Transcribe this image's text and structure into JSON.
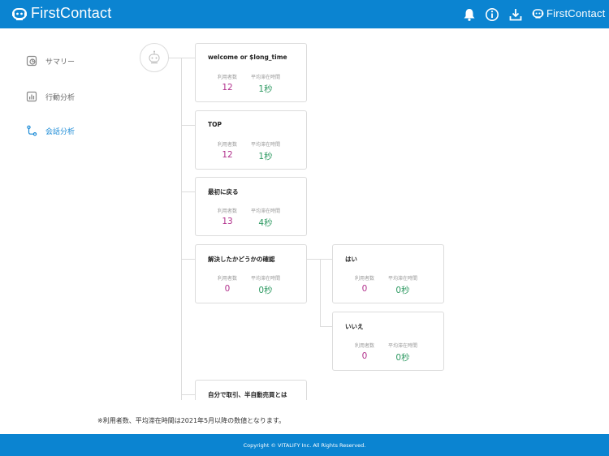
{
  "header": {
    "brand": "FirstContact",
    "brand_right": "FirstContact",
    "icons": [
      "bell-icon",
      "info-icon",
      "download-icon"
    ]
  },
  "sidebar": {
    "items": [
      {
        "label": "サマリー",
        "icon": "summary-icon",
        "active": false
      },
      {
        "label": "行動分析",
        "icon": "chart-icon",
        "active": false
      },
      {
        "label": "会話分析",
        "icon": "flow-icon",
        "active": true
      }
    ]
  },
  "flow": {
    "start_icon": "robot-icon",
    "cards": [
      {
        "title": "welcome or $long_time",
        "users_label": "利用者数",
        "users": "12",
        "time_label": "平均滞在時間",
        "time": "1秒"
      },
      {
        "title": "TOP",
        "users_label": "利用者数",
        "users": "12",
        "time_label": "平均滞在時間",
        "time": "1秒"
      },
      {
        "title": "最初に戻る",
        "users_label": "利用者数",
        "users": "13",
        "time_label": "平均滞在時間",
        "time": "4秒"
      },
      {
        "title": "解決したかどうかの確認",
        "users_label": "利用者数",
        "users": "0",
        "time_label": "平均滞在時間",
        "time": "0秒"
      },
      {
        "title": "はい",
        "users_label": "利用者数",
        "users": "0",
        "time_label": "平均滞在時間",
        "time": "0秒"
      },
      {
        "title": "いいえ",
        "users_label": "利用者数",
        "users": "0",
        "time_label": "平均滞在時間",
        "time": "0秒"
      },
      {
        "title": "自分で取引、半自動売買とは",
        "users_label": "",
        "users": "",
        "time_label": "",
        "time": ""
      }
    ]
  },
  "note": "※利用者数、平均滞在時間は2021年5月以降の数値となります。",
  "footer": {
    "copyright": "Copyright © VITALIFY Inc. All Rights Reserved."
  },
  "colors": {
    "brand": "#0b84d1",
    "users_value": "#b1308c",
    "time_value": "#2f9a63",
    "active_nav": "#1a8ad6"
  }
}
